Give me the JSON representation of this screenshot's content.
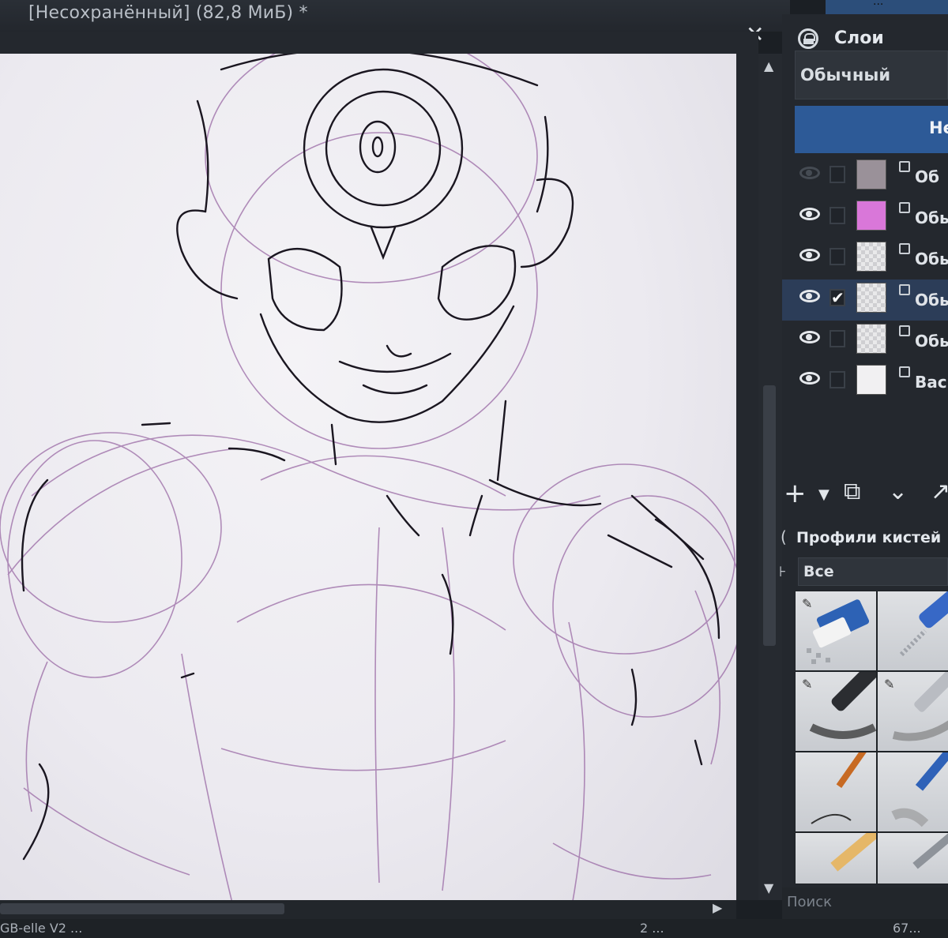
{
  "window": {
    "title": "[Несохранённый]  (82,8 МиБ) *",
    "close_glyph": "✕",
    "top_strip_text": "..."
  },
  "statusbar": {
    "left": "GB-elle V2 ...",
    "center": "2 ...",
    "right": "67..."
  },
  "layers_panel": {
    "title": "Слои",
    "blend_mode": "Обычный",
    "opacity_label": "Не",
    "layers": [
      {
        "name": "Об",
        "visible": false,
        "checked": false,
        "thumb": "grey"
      },
      {
        "name": "Обы",
        "visible": true,
        "checked": false,
        "thumb": "pink"
      },
      {
        "name": "Обы",
        "visible": true,
        "checked": false,
        "thumb": "check"
      },
      {
        "name": "Обы",
        "visible": true,
        "checked": true,
        "thumb": "check",
        "selected": true
      },
      {
        "name": "Обы",
        "visible": true,
        "checked": false,
        "thumb": "check"
      },
      {
        "name": "Backg",
        "visible": true,
        "checked": false,
        "thumb": "white"
      }
    ],
    "tools": [
      "add-icon",
      "dropdown-icon",
      "duplicate-icon",
      "chevron-down-icon",
      "arrow-up-icon"
    ]
  },
  "brush_panel": {
    "title": "Профили кистей",
    "tag_filter": "Все",
    "search_placeholder": "Поиск",
    "presets": [
      "eraser",
      "blue-marker",
      "black-marker",
      "pencil-grey",
      "brush",
      "pencil-blue",
      "pencil-yellow",
      "pencil-mech"
    ]
  },
  "colors": {
    "accent": "#2d5a97",
    "selected_layer": "#2c3d58",
    "sketch_line": "#1a1620",
    "sketch_purple": "#9a6aa5"
  }
}
